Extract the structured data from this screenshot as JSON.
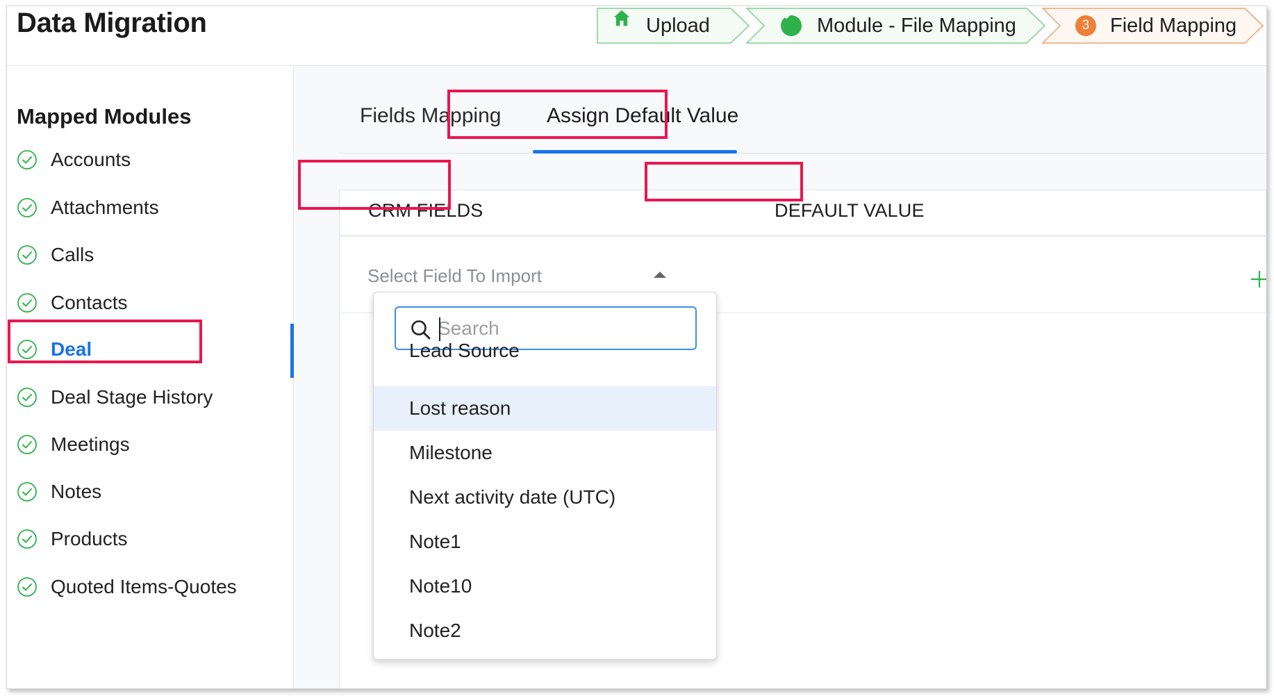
{
  "header": {
    "title": "Data Migration",
    "steps": [
      {
        "label": "Upload",
        "status": "home"
      },
      {
        "label": "Module - File Mapping",
        "status": "done"
      },
      {
        "label": "Field Mapping",
        "status": "current",
        "number": "3"
      }
    ]
  },
  "sidebar": {
    "title": "Mapped Modules",
    "items": [
      {
        "label": "Accounts"
      },
      {
        "label": "Attachments"
      },
      {
        "label": "Calls"
      },
      {
        "label": "Contacts"
      },
      {
        "label": "Deal"
      },
      {
        "label": "Deal Stage History"
      },
      {
        "label": "Meetings"
      },
      {
        "label": "Notes"
      },
      {
        "label": "Products"
      },
      {
        "label": "Quoted Items-Quotes"
      }
    ],
    "active_item": "Deal"
  },
  "tabs": [
    {
      "label": "Fields Mapping"
    },
    {
      "label": "Assign Default Value"
    }
  ],
  "active_tab": "Assign Default Value",
  "table": {
    "columns": [
      "CRM FIELDS",
      "DEFAULT VALUE"
    ],
    "select_placeholder": "Select Field To Import"
  },
  "dropdown": {
    "search_placeholder": "Search",
    "options": [
      "Lead Source",
      "Lost reason",
      "Milestone",
      "Next activity date (UTC)",
      "Note1",
      "Note10",
      "Note2"
    ],
    "highlighted": "Lost reason"
  },
  "colors": {
    "accent": "#1a73e8",
    "success": "#2fb24c",
    "current_step": "#f07f37",
    "annotation": "#e8174f"
  },
  "icons": {
    "step_1": "home-icon",
    "step_2": "check-circle-icon",
    "sidebar": "check-circle-outline-icon",
    "search": "search-icon",
    "add": "plus-icon"
  }
}
